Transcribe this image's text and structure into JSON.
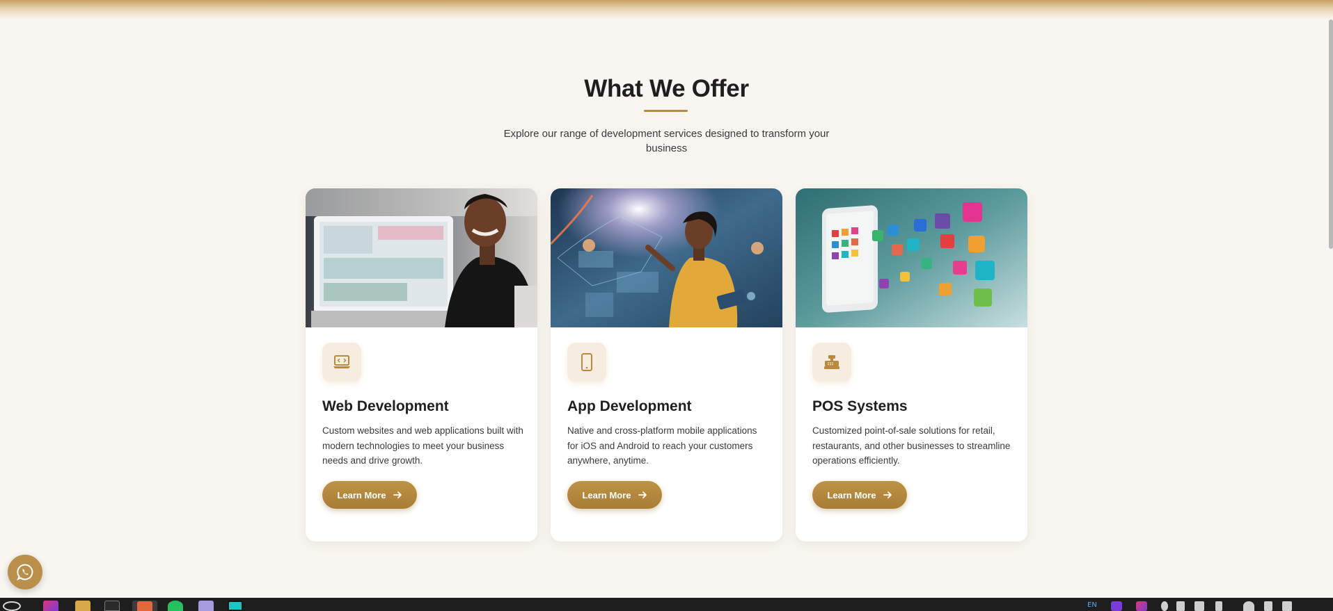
{
  "section": {
    "title": "What We Offer",
    "subtitle": "Explore our range of development services designed to transform your business"
  },
  "cards": [
    {
      "title": "Web Development",
      "description": "Custom websites and web applications built with modern technologies to meet your business needs and drive growth.",
      "button_label": "Learn More",
      "icon": "laptop-code-icon",
      "image": "woman-at-computer-photo"
    },
    {
      "title": "App Development",
      "description": "Native and cross-platform mobile applications for iOS and Android to reach your customers anywhere, anytime.",
      "button_label": "Learn More",
      "icon": "mobile-phone-icon",
      "image": "woman-touching-holographic-interface-photo"
    },
    {
      "title": "POS Systems",
      "description": "Customized point-of-sale solutions for retail, restaurants, and other businesses to streamline operations efficiently.",
      "button_label": "Learn More",
      "icon": "cash-register-icon",
      "image": "tablet-with-app-icons-photo"
    }
  ],
  "floating": {
    "icon": "whatsapp-icon"
  },
  "taskbar": {
    "apps": [
      "start-icon",
      "jetbrains-icon",
      "file-manager-icon",
      "terminal-icon",
      "app-icon",
      "whatsapp-icon",
      "chat-icon",
      "pycharm-icon"
    ],
    "tray_text": "EN"
  },
  "colors": {
    "accent": "#b8893e",
    "background": "#f9f6f1",
    "card": "#ffffff",
    "icon_tile": "#f6ecdf"
  }
}
